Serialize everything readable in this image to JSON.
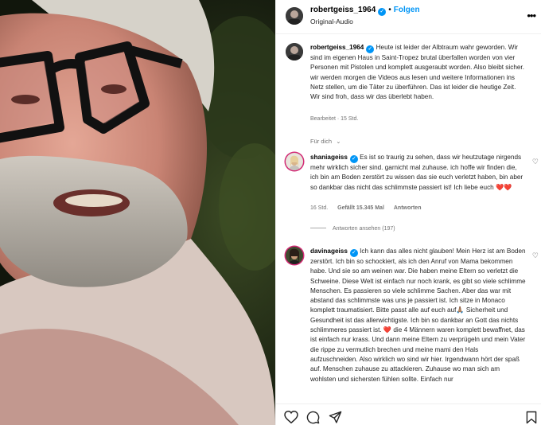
{
  "post": {
    "username": "robertgeiss_1964",
    "separator": "•",
    "follow_label": "Folgen",
    "audio_label": "Original-Audio",
    "more_label": "•••"
  },
  "caption": {
    "username": "robertgeiss_1964",
    "text": "Heute ist leider der Albtraum wahr geworden. Wir sind im eigenen Haus in Saint-Tropez brutal überfallen worden von vier Personen mit Pistolen und komplett ausgeraubt worden. Also bleibt sicher. wir werden morgen die Videos aus lesen und weitere Informationen ins Netz stellen, um die Täter zu überführen. Das ist leider die heutige Zeit. Wir sind froh, dass wir das überlebt haben.",
    "edited": "Bearbeitet · 15 Std."
  },
  "for_you_label": "Für dich",
  "comments": [
    {
      "username": "shaniageiss",
      "text": "Es ist so traurig zu sehen, dass wir heutzutage nirgends mehr wirklich sicher sind. garnicht mal zuhause. ich hoffe wir finden die, ich bin am Boden zerstört zu wissen das sie euch verletzt haben, bin aber so dankbar das nicht das schlimmste passiert ist! Ich liebe euch",
      "emoji": "❤️❤️",
      "time": "16 Std.",
      "likes": "Gefällt 15.345 Mal",
      "reply_label": "Antworten",
      "view_replies": "Antworten ansehen (197)"
    },
    {
      "username": "davinageiss",
      "text": "Ich kann das alles nicht glauben! Mein Herz ist am Boden zerstört. Ich bin so schockiert, als ich den Anruf von Mama bekommen habe. Und sie so am weinen war. Die haben meine Eltern so verletzt die Schweine. Diese Welt ist einfach nur noch krank, es gibt so viele schlimme Menschen. Es passieren so viele schlimme Sachen. Aber das war mit abstand das schlimmste was uns je passiert ist. Ich sitze in Monaco komplett traumatisiert. Bitte passt alle auf euch auf🙏🏽 Sicherheit und Gesundheit ist das allerwichtigste. Ich bin so dankbar an Gott das nichts schlimmeres passiert ist. ❤️ die 4 Männern waren komplett bewaffnet, das ist einfach nur krass. Und dann meine Eltern zu verprügeln und mein Vater die rippe zu vermutlich brechen und meine mami den Hals aufzuschneiden. Also wirklich wo sind wir hier. Irgendwann hört der spaß auf. Menschen zuhause zu attackieren. Zuhause wo man sich am wohlsten und sichersten fühlen sollte. Einfach nur"
    }
  ],
  "icons": {
    "verified": "verified-badge-icon",
    "heart": "heart-icon",
    "comment": "comment-icon",
    "share": "share-icon",
    "save": "bookmark-icon",
    "chevron": "chevron-down-icon"
  },
  "glyphs": {
    "verified": "✓",
    "heart_outline": "♡",
    "chevron": "⌄"
  }
}
